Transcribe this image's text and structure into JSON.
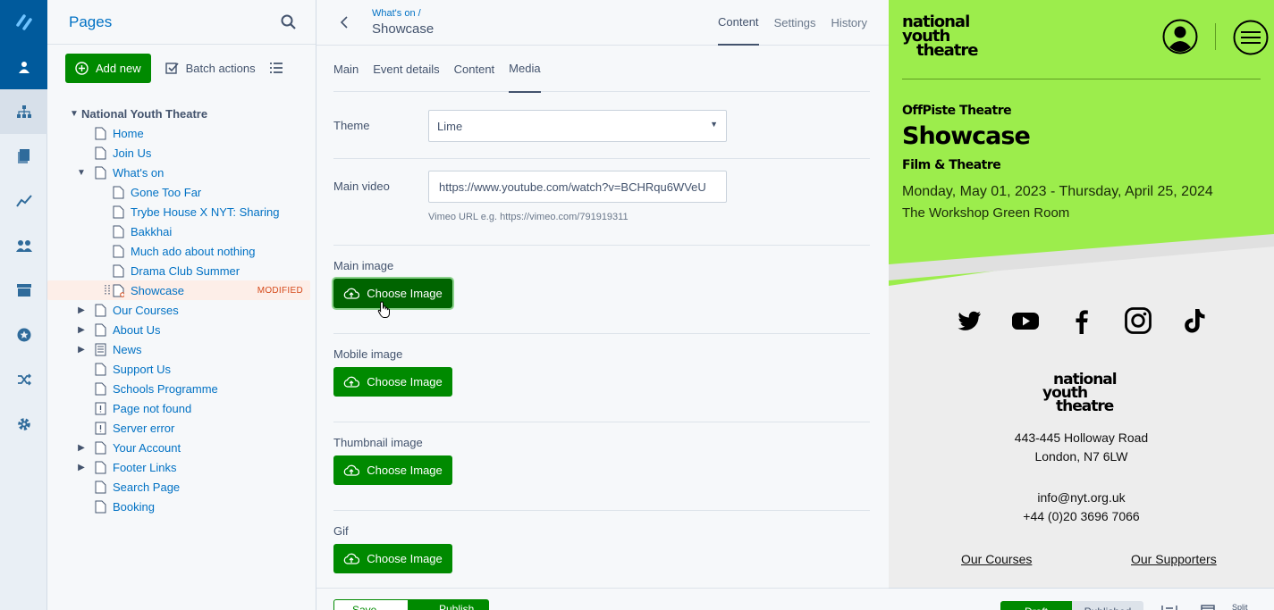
{
  "tree": {
    "title": "Pages",
    "add_label": "Add new",
    "batch_label": "Batch actions",
    "root": "National Youth Theatre",
    "modified_badge": "MODIFIED",
    "items": [
      {
        "label": "Home"
      },
      {
        "label": "Join Us"
      },
      {
        "label": "What's on"
      },
      {
        "label": "Gone Too Far"
      },
      {
        "label": "Trybe House X NYT: Sharing"
      },
      {
        "label": "Bakkhai"
      },
      {
        "label": "Much ado about nothing"
      },
      {
        "label": "Drama Club Summer"
      },
      {
        "label": "Showcase"
      },
      {
        "label": "Our Courses"
      },
      {
        "label": "About Us"
      },
      {
        "label": "News"
      },
      {
        "label": "Support Us"
      },
      {
        "label": "Schools Programme"
      },
      {
        "label": "Page not found"
      },
      {
        "label": "Server error"
      },
      {
        "label": "Your Account"
      },
      {
        "label": "Footer Links"
      },
      {
        "label": "Search Page"
      },
      {
        "label": "Booking"
      }
    ]
  },
  "editor": {
    "breadcrumb": "What's on /",
    "title": "Showcase",
    "tabs": [
      "Content",
      "Settings",
      "History"
    ],
    "sub_tabs": [
      "Main",
      "Event details",
      "Content",
      "Media"
    ],
    "theme_label": "Theme",
    "theme_value": "Lime",
    "video_label": "Main video",
    "video_value": "https://www.youtube.com/watch?v=BCHRqu6WVeU",
    "video_hint": "Vimeo URL e.g. https://vimeo.com/791919311",
    "main_image_label": "Main image",
    "mobile_image_label": "Mobile image",
    "thumbnail_image_label": "Thumbnail image",
    "gif_label": "Gif",
    "choose_label": "Choose Image",
    "footer_save": "Save",
    "footer_publish": "Publish",
    "footer_more": "..."
  },
  "preview": {
    "logo_lines": [
      "national",
      "youth",
      "theatre"
    ],
    "subtitle": "OffPiste Theatre",
    "title": "Showcase",
    "category": "Film & Theatre",
    "date": "Monday, May 01, 2023 - Thursday, April 25, 2024",
    "venue": "The Workshop Green Room",
    "address_1": "443-445 Holloway Road",
    "address_2": "London, N7 6LW",
    "email": "info@nyt.org.uk",
    "phone": "+44 (0)20 3696 7066",
    "link_1": "Our Courses",
    "link_2": "Our Supporters",
    "draft_label": "Draft",
    "published_label": "Published",
    "split_label": "Split",
    "accent": "#9ced4c"
  },
  "colors": {
    "primary": "#0071c4",
    "rail_active": "#005a9c",
    "button_green": "#008a00",
    "modified": "#d5491a"
  }
}
